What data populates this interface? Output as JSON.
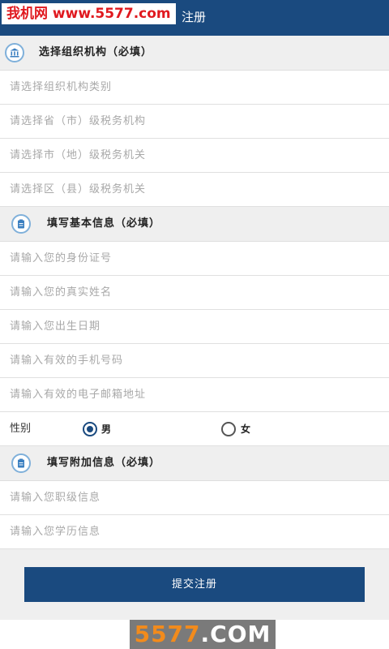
{
  "header": {
    "watermark": "我机网 www.5577.com",
    "title": "注册"
  },
  "sections": {
    "org": "选择组织机构（必填）",
    "basic": "填写基本信息（必填）",
    "extra": "填写附加信息（必填）"
  },
  "org_fields": [
    "请选择组织机构类别",
    "请选择省（市）级税务机构",
    "请选择市（地）级税务机关",
    "请选择区（县）级税务机关"
  ],
  "basic_fields": [
    "请输入您的身份证号",
    "请输入您的真实姓名",
    "请输入您出生日期",
    "请输入有效的手机号码",
    "请输入有效的电子邮箱地址"
  ],
  "gender": {
    "label": "性别",
    "male": "男",
    "female": "女",
    "selected": "男"
  },
  "extra_fields": [
    "请输入您职级信息",
    "请输入您学历信息"
  ],
  "submit_label": "提交注册",
  "watermark_bottom": {
    "num": "5577",
    "suffix": ".COM"
  },
  "colors": {
    "primary": "#1a4a7f",
    "watermark_red": "#e0191f",
    "placeholder": "#a8a8a8"
  }
}
